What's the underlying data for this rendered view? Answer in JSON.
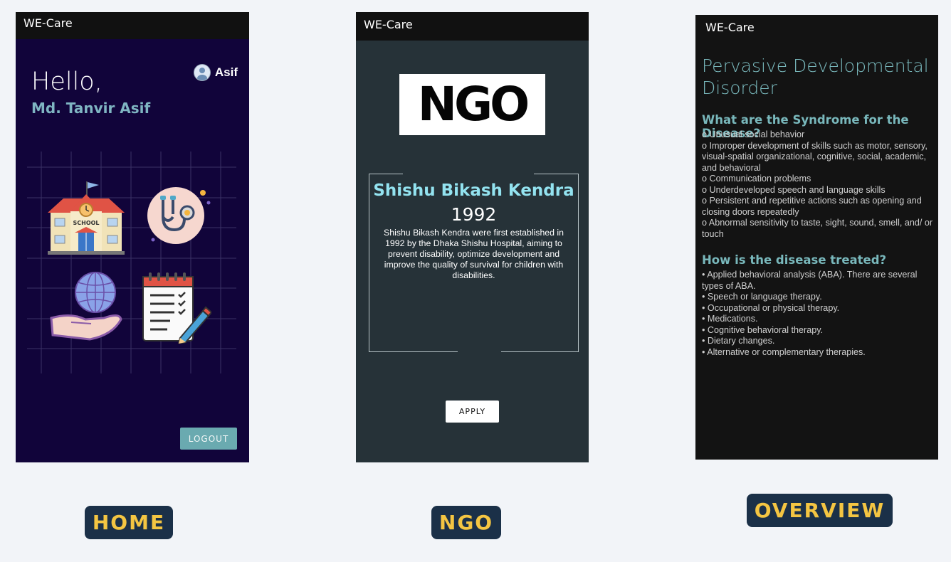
{
  "home": {
    "app_title": "WE-Care",
    "greeting": "Hello,",
    "full_name": "Md. Tanvir Asif",
    "user_short": "Asif",
    "logout_label": "LOGOUT",
    "school_sign": "SCHOOL",
    "tiles": [
      "school-icon",
      "stethoscope-icon",
      "globe-in-hand-icon",
      "checklist-icon"
    ]
  },
  "ngo": {
    "app_title": "WE-Care",
    "logo_text": "NGO",
    "org_name": "Shishu Bikash Kendra",
    "year": "1992",
    "description": "Shishu Bikash Kendra were first established in 1992 by the Dhaka Shishu Hospital, aiming to prevent disability, optimize development and improve the quality of survival for children with disabilities.",
    "apply_label": "APPLY"
  },
  "overview": {
    "app_title": "WE-Care",
    "disease_title": "Pervasive Developmental Disorder",
    "syndrome_heading": "What are the Syndrome for the Disease?",
    "syndromes": [
      "o  Unusual social behavior",
      "o  Improper development of skills such as motor, sensory, visual-spatial organizational, cognitive, social, academic, and behavioral",
      "o  Communication problems",
      "o  Underdeveloped speech and language skills",
      "o  Persistent and repetitive actions such as opening and closing doors repeatedly",
      "o  Abnormal sensitivity to taste, sight, sound, smell, and/ or touch"
    ],
    "treatment_heading": "How is the disease treated?",
    "treatments": [
      "• Applied behavioral analysis (ABA). There are several types of ABA.",
      "• Speech or language therapy.",
      "• Occupational or physical therapy.",
      "• Medications.",
      "• Cognitive behavioral therapy.",
      "• Dietary changes.",
      "• Alternative or complementary therapies."
    ]
  },
  "captions": {
    "home": "HOME",
    "ngo": "NGO",
    "overview": "OVERVIEW"
  },
  "colors": {
    "home_bg": "#11043a",
    "ngo_bg": "#263238",
    "overview_bg": "#131313",
    "accent": "#79b8bc",
    "caption_bg": "#1b3048",
    "caption_text": "#f4c542"
  }
}
